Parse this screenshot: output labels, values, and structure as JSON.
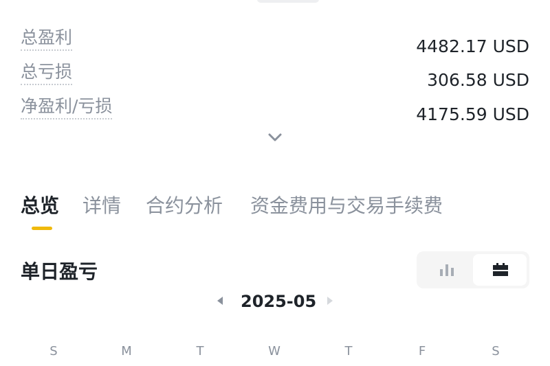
{
  "summary": {
    "total_profit": {
      "label": "总盈利",
      "value": "4482.17 USD"
    },
    "total_loss": {
      "label": "总亏损",
      "value": "306.58 USD"
    },
    "net_pnl": {
      "label": "净盈利/亏损",
      "value": "4175.59 USD"
    }
  },
  "tabs": [
    {
      "label": "总览",
      "active": true
    },
    {
      "label": "详情",
      "active": false
    },
    {
      "label": "合约分析",
      "active": false
    },
    {
      "label": "资金费用与交易手续费",
      "active": false
    }
  ],
  "daily_pnl": {
    "title": "单日盈亏",
    "view_mode": "calendar",
    "month": "2025-05"
  },
  "weekdays": [
    "S",
    "M",
    "T",
    "W",
    "T",
    "F",
    "S"
  ],
  "colors": {
    "accent": "#f0b90b",
    "text_primary": "#1e2329",
    "text_secondary": "#8a919c"
  },
  "icons": {
    "expand": "chevron-down-icon",
    "chart_view": "bar-chart-icon",
    "calendar_view": "calendar-icon",
    "prev_month": "caret-left-icon",
    "next_month": "caret-right-icon"
  }
}
